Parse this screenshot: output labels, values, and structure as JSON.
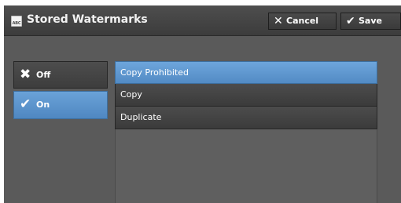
{
  "header": {
    "app_icon_text": "ABC",
    "title": "Stored Watermarks",
    "cancel_label": "Cancel",
    "save_label": "Save"
  },
  "toggle": {
    "selected": "On",
    "off_label": "Off",
    "on_label": "On"
  },
  "watermarks": {
    "selected": "Copy Prohibited",
    "items": [
      {
        "label": "Copy Prohibited"
      },
      {
        "label": "Copy"
      },
      {
        "label": "Duplicate"
      }
    ]
  },
  "colors": {
    "panel_bg": "#5a5a5a",
    "header_bg": "#444444",
    "selected_accent": "#5f97cf",
    "button_bg": "#424242",
    "text": "#ffffff"
  },
  "icons": {
    "app": "abc-document-icon",
    "cancel": "x-icon",
    "save": "checkmark-icon",
    "off": "x-icon",
    "on": "checkmark-icon"
  }
}
